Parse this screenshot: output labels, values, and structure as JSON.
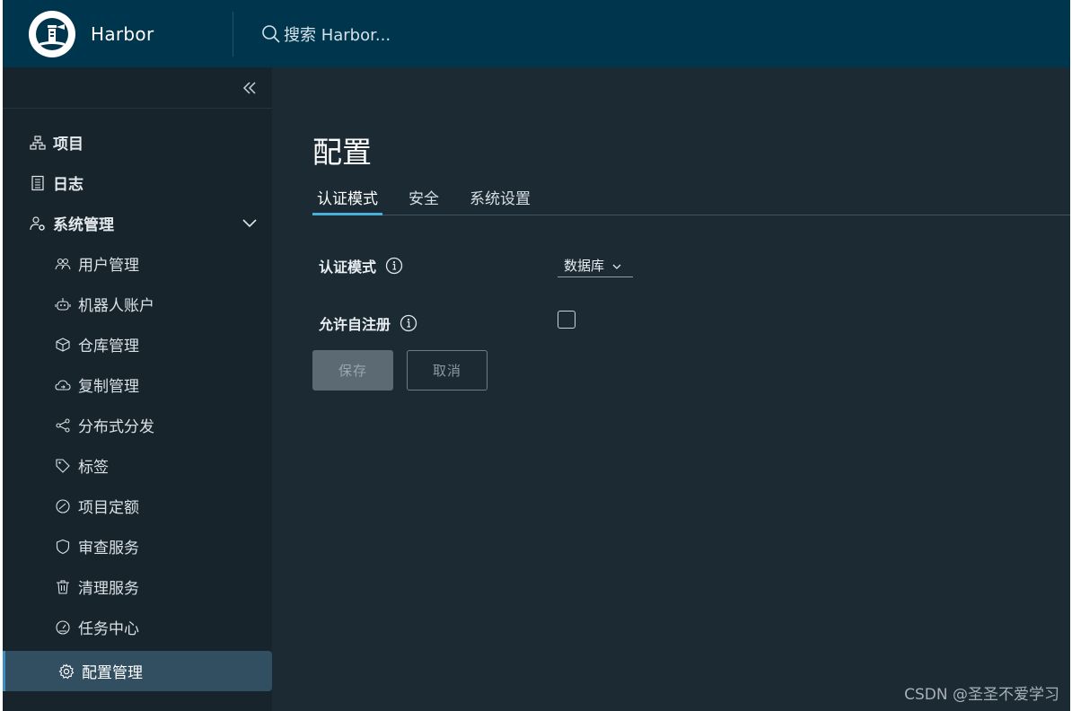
{
  "header": {
    "brand": "Harbor",
    "search_placeholder": "搜索 Harbor..."
  },
  "sidebar": {
    "items": [
      {
        "label": "项目",
        "icon": "project-icon"
      },
      {
        "label": "日志",
        "icon": "log-icon"
      },
      {
        "label": "系统管理",
        "icon": "admin-icon"
      }
    ],
    "sub_items": [
      {
        "label": "用户管理",
        "icon": "users-icon"
      },
      {
        "label": "机器人账户",
        "icon": "robot-icon"
      },
      {
        "label": "仓库管理",
        "icon": "cube-icon"
      },
      {
        "label": "复制管理",
        "icon": "cloud-sync-icon"
      },
      {
        "label": "分布式分发",
        "icon": "share-icon"
      },
      {
        "label": "标签",
        "icon": "tag-icon"
      },
      {
        "label": "项目定额",
        "icon": "gauge-icon"
      },
      {
        "label": "审查服务",
        "icon": "shield-icon"
      },
      {
        "label": "清理服务",
        "icon": "trash-icon"
      },
      {
        "label": "任务中心",
        "icon": "dashboard-icon"
      },
      {
        "label": "配置管理",
        "icon": "gear-icon",
        "active": true
      }
    ]
  },
  "main": {
    "title": "配置",
    "tabs": [
      {
        "label": "认证模式",
        "active": true
      },
      {
        "label": "安全"
      },
      {
        "label": "系统设置"
      }
    ],
    "auth_mode_label": "认证模式",
    "auth_mode_value": "数据库",
    "self_reg_label": "允许自注册",
    "self_reg_checked": false,
    "save_label": "保存",
    "cancel_label": "取消"
  },
  "watermark": "CSDN @圣圣不爱学习",
  "colors": {
    "header_bg": "#00364d",
    "sidebar_bg": "#17242b",
    "main_bg": "#1c2a33",
    "active_item_bg": "#324f61",
    "tab_accent": "#49afd9"
  }
}
